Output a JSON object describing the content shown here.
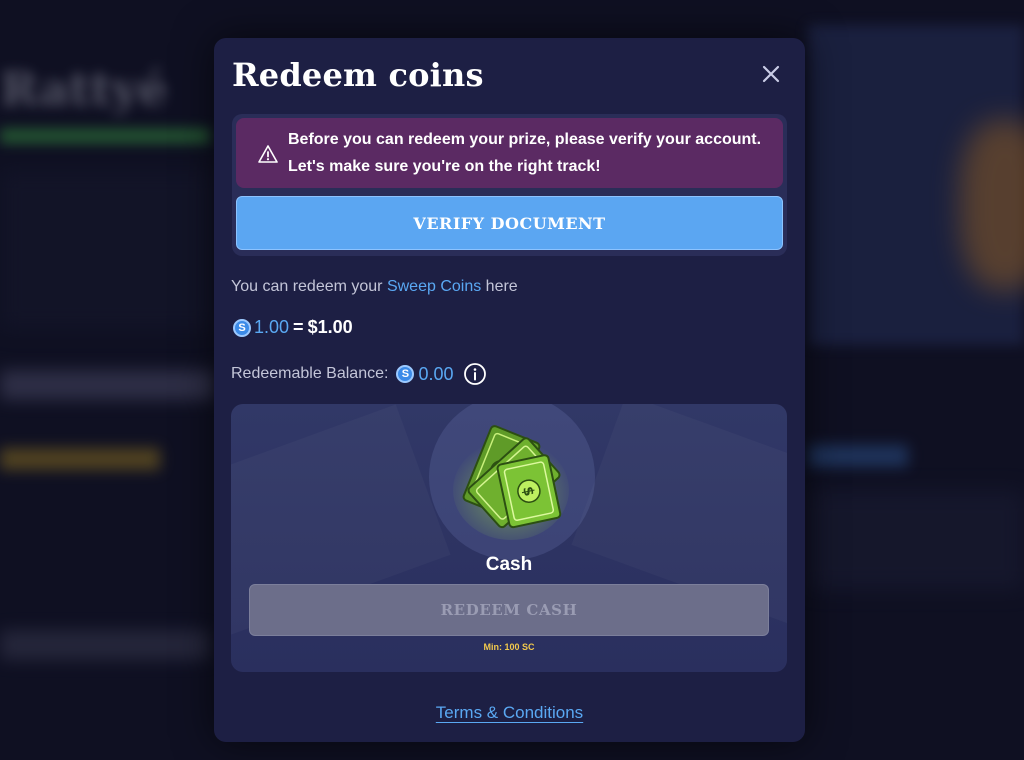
{
  "modal": {
    "title": "Redeem coins",
    "close_icon": "close-icon"
  },
  "verify": {
    "warning_text": "Before you can redeem your prize, please verify your account. Let's make sure you're on the right track!",
    "warning_icon": "warning-triangle-icon",
    "button_label": "VERIFY DOCUMENT"
  },
  "redeem_info": {
    "prefix": "You can redeem your ",
    "link_text": "Sweep Coins",
    "suffix": " here"
  },
  "rate": {
    "coin_symbol": "S",
    "sc_value": "1.00",
    "equals": "=",
    "usd_value": "$1.00"
  },
  "balance": {
    "label": "Redeemable Balance:",
    "value": "0.00",
    "info_icon": "info-icon"
  },
  "cash_card": {
    "label": "Cash",
    "button_label": "REDEEM CASH",
    "min_text": "Min: 100 SC",
    "art_icon": "money-bills-icon"
  },
  "footer": {
    "terms_label": "Terms & Conditions"
  },
  "colors": {
    "modal_bg": "#1d1f44",
    "warning_bg": "#5b2a63",
    "primary_button": "#5ba6f2",
    "link": "#5aa8f3",
    "disabled_button": "#6c6e8a",
    "min_text": "#f2c94c"
  }
}
